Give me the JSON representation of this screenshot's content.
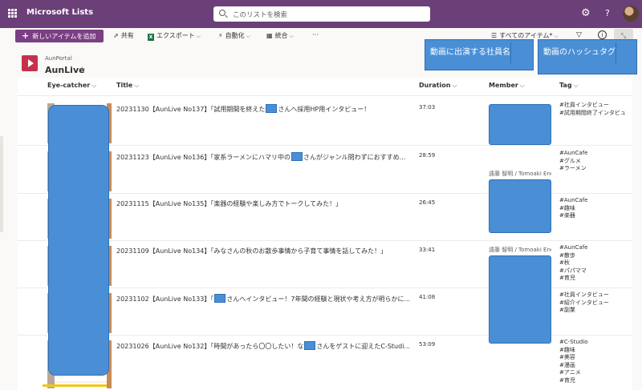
{
  "topbar": {
    "app_name": "Microsoft Lists",
    "search_placeholder": "このリストを検索",
    "gear_icon": "⚙",
    "help_icon": "?"
  },
  "commands": {
    "new_item": "新しいアイテムを追加",
    "share": "共有",
    "export": "エクスポート",
    "automate": "自動化",
    "integrate": "統合",
    "more": "···",
    "view": "すべてのアイテム*"
  },
  "list": {
    "site": "AunPortal",
    "name": "AunLive",
    "favorite_icon": "☆"
  },
  "annotations": {
    "member": "動画に出演する社員名",
    "tag": "動画のハッシュタグ"
  },
  "columns": {
    "eyecatcher": "Eye-catcher",
    "title": "Title",
    "duration": "Duration",
    "member": "Member",
    "tag": "Tag"
  },
  "rows": [
    {
      "title_a": "20231130【AunLive No137】「試用期間を終えた",
      "title_b": "さんへ採用HP用インタビュー！",
      "duration": "37:03",
      "member": "",
      "tags": [
        "#社員インタビュー",
        "#試用期間終了インタビュ"
      ]
    },
    {
      "title_a": "20231123【AunLive No136】「家系ラーメンにハマリ中の",
      "title_b": "さんがジャンル問わずにおすすめ...",
      "duration": "28:59",
      "member": "遠藤 智明 / Tomoaki Endo",
      "tags": [
        "#AunCafe",
        "#グルメ",
        "#ラーメン"
      ]
    },
    {
      "title_a": "20231115【AunLive No135】「楽器の経験や楽しみ方でトークしてみた！」",
      "title_b": "",
      "duration": "26:45",
      "member": "",
      "tags": [
        "#AunCafe",
        "#趣味",
        "#楽器"
      ]
    },
    {
      "title_a": "20231109【AunLive No134】「みなさんの秋のお散歩事情から子育て事情を話してみた！」",
      "title_b": "",
      "duration": "33:41",
      "member": "遠藤 智明 / Tomoaki Endo",
      "tags": [
        "#AunCafe",
        "#散歩",
        "#秋",
        "#パパママ",
        "#育児"
      ]
    },
    {
      "title_a": "20231102【AunLive No133】「",
      "title_b": "さんへインタビュー！7年間の経験と現状や考え方が明らかに...",
      "duration": "41:08",
      "member": "",
      "tags": [
        "#社員インタビュー",
        "#紹介インタビュー",
        "#副業"
      ]
    },
    {
      "title_a": "20231026【AunLive No132】「時間があったら〇〇したい！な",
      "title_b": "さんをゲストに迎えたC-Studi...",
      "duration": "53:09",
      "member": "",
      "tags": [
        "#C-Studio",
        "#趣味",
        "#美容",
        "#漫画",
        "#アニメ",
        "#育児"
      ]
    }
  ]
}
